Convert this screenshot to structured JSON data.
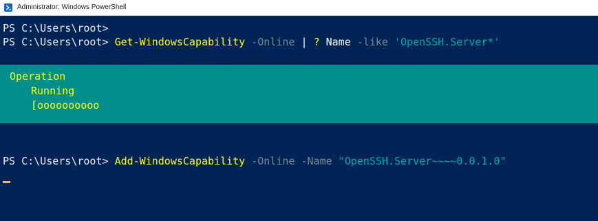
{
  "window": {
    "title": "Administrator: Windows PowerShell",
    "icon": "powershell-icon"
  },
  "console": {
    "line1": {
      "prompt": "PS C:\\Users\\root>"
    },
    "line2": {
      "prompt": "PS C:\\Users\\root> ",
      "cmdlet": "Get-WindowsCapability",
      "param1": " -Online ",
      "pipe": "| ",
      "alias": "?",
      "arg": " Name ",
      "param2": "-like ",
      "string": "'OpenSSH.Server*'"
    },
    "progress": {
      "activity": "Operation",
      "status": "Running",
      "bar": "[oooooooooo"
    },
    "line3": {
      "prompt": "PS C:\\Users\\root> ",
      "cmdlet": "Add-WindowsCapability",
      "param1": " -Online ",
      "param2": "-Name ",
      "string": "\"OpenSSH.Server~~~~0.0.1.0\""
    }
  },
  "colors": {
    "background": "#012456",
    "progress_background": "#008f8c",
    "command": "#ffff00",
    "parameter": "#7d8790",
    "string": "#00a8a8",
    "cursor": "#eeba78"
  }
}
